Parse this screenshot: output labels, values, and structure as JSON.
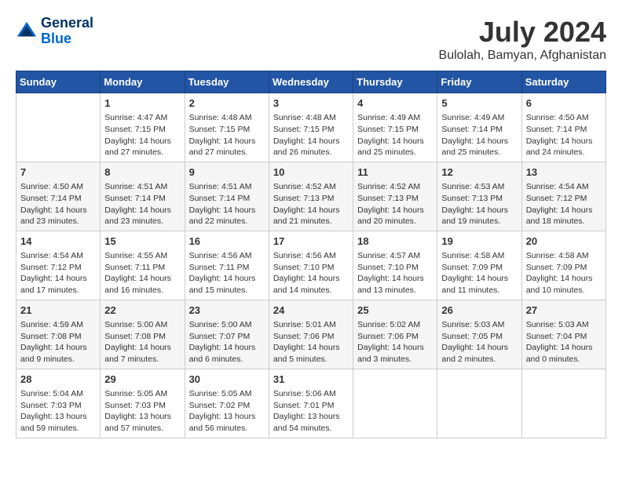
{
  "logo": {
    "line1": "General",
    "line2": "Blue"
  },
  "title": "July 2024",
  "subtitle": "Bulolah, Bamyan, Afghanistan",
  "headers": [
    "Sunday",
    "Monday",
    "Tuesday",
    "Wednesday",
    "Thursday",
    "Friday",
    "Saturday"
  ],
  "weeks": [
    [
      {
        "day": "",
        "lines": []
      },
      {
        "day": "1",
        "lines": [
          "Sunrise: 4:47 AM",
          "Sunset: 7:15 PM",
          "Daylight: 14 hours",
          "and 27 minutes."
        ]
      },
      {
        "day": "2",
        "lines": [
          "Sunrise: 4:48 AM",
          "Sunset: 7:15 PM",
          "Daylight: 14 hours",
          "and 27 minutes."
        ]
      },
      {
        "day": "3",
        "lines": [
          "Sunrise: 4:48 AM",
          "Sunset: 7:15 PM",
          "Daylight: 14 hours",
          "and 26 minutes."
        ]
      },
      {
        "day": "4",
        "lines": [
          "Sunrise: 4:49 AM",
          "Sunset: 7:15 PM",
          "Daylight: 14 hours",
          "and 25 minutes."
        ]
      },
      {
        "day": "5",
        "lines": [
          "Sunrise: 4:49 AM",
          "Sunset: 7:14 PM",
          "Daylight: 14 hours",
          "and 25 minutes."
        ]
      },
      {
        "day": "6",
        "lines": [
          "Sunrise: 4:50 AM",
          "Sunset: 7:14 PM",
          "Daylight: 14 hours",
          "and 24 minutes."
        ]
      }
    ],
    [
      {
        "day": "7",
        "lines": [
          "Sunrise: 4:50 AM",
          "Sunset: 7:14 PM",
          "Daylight: 14 hours",
          "and 23 minutes."
        ]
      },
      {
        "day": "8",
        "lines": [
          "Sunrise: 4:51 AM",
          "Sunset: 7:14 PM",
          "Daylight: 14 hours",
          "and 23 minutes."
        ]
      },
      {
        "day": "9",
        "lines": [
          "Sunrise: 4:51 AM",
          "Sunset: 7:14 PM",
          "Daylight: 14 hours",
          "and 22 minutes."
        ]
      },
      {
        "day": "10",
        "lines": [
          "Sunrise: 4:52 AM",
          "Sunset: 7:13 PM",
          "Daylight: 14 hours",
          "and 21 minutes."
        ]
      },
      {
        "day": "11",
        "lines": [
          "Sunrise: 4:52 AM",
          "Sunset: 7:13 PM",
          "Daylight: 14 hours",
          "and 20 minutes."
        ]
      },
      {
        "day": "12",
        "lines": [
          "Sunrise: 4:53 AM",
          "Sunset: 7:13 PM",
          "Daylight: 14 hours",
          "and 19 minutes."
        ]
      },
      {
        "day": "13",
        "lines": [
          "Sunrise: 4:54 AM",
          "Sunset: 7:12 PM",
          "Daylight: 14 hours",
          "and 18 minutes."
        ]
      }
    ],
    [
      {
        "day": "14",
        "lines": [
          "Sunrise: 4:54 AM",
          "Sunset: 7:12 PM",
          "Daylight: 14 hours",
          "and 17 minutes."
        ]
      },
      {
        "day": "15",
        "lines": [
          "Sunrise: 4:55 AM",
          "Sunset: 7:11 PM",
          "Daylight: 14 hours",
          "and 16 minutes."
        ]
      },
      {
        "day": "16",
        "lines": [
          "Sunrise: 4:56 AM",
          "Sunset: 7:11 PM",
          "Daylight: 14 hours",
          "and 15 minutes."
        ]
      },
      {
        "day": "17",
        "lines": [
          "Sunrise: 4:56 AM",
          "Sunset: 7:10 PM",
          "Daylight: 14 hours",
          "and 14 minutes."
        ]
      },
      {
        "day": "18",
        "lines": [
          "Sunrise: 4:57 AM",
          "Sunset: 7:10 PM",
          "Daylight: 14 hours",
          "and 13 minutes."
        ]
      },
      {
        "day": "19",
        "lines": [
          "Sunrise: 4:58 AM",
          "Sunset: 7:09 PM",
          "Daylight: 14 hours",
          "and 11 minutes."
        ]
      },
      {
        "day": "20",
        "lines": [
          "Sunrise: 4:58 AM",
          "Sunset: 7:09 PM",
          "Daylight: 14 hours",
          "and 10 minutes."
        ]
      }
    ],
    [
      {
        "day": "21",
        "lines": [
          "Sunrise: 4:59 AM",
          "Sunset: 7:08 PM",
          "Daylight: 14 hours",
          "and 9 minutes."
        ]
      },
      {
        "day": "22",
        "lines": [
          "Sunrise: 5:00 AM",
          "Sunset: 7:08 PM",
          "Daylight: 14 hours",
          "and 7 minutes."
        ]
      },
      {
        "day": "23",
        "lines": [
          "Sunrise: 5:00 AM",
          "Sunset: 7:07 PM",
          "Daylight: 14 hours",
          "and 6 minutes."
        ]
      },
      {
        "day": "24",
        "lines": [
          "Sunrise: 5:01 AM",
          "Sunset: 7:06 PM",
          "Daylight: 14 hours",
          "and 5 minutes."
        ]
      },
      {
        "day": "25",
        "lines": [
          "Sunrise: 5:02 AM",
          "Sunset: 7:06 PM",
          "Daylight: 14 hours",
          "and 3 minutes."
        ]
      },
      {
        "day": "26",
        "lines": [
          "Sunrise: 5:03 AM",
          "Sunset: 7:05 PM",
          "Daylight: 14 hours",
          "and 2 minutes."
        ]
      },
      {
        "day": "27",
        "lines": [
          "Sunrise: 5:03 AM",
          "Sunset: 7:04 PM",
          "Daylight: 14 hours",
          "and 0 minutes."
        ]
      }
    ],
    [
      {
        "day": "28",
        "lines": [
          "Sunrise: 5:04 AM",
          "Sunset: 7:03 PM",
          "Daylight: 13 hours",
          "and 59 minutes."
        ]
      },
      {
        "day": "29",
        "lines": [
          "Sunrise: 5:05 AM",
          "Sunset: 7:03 PM",
          "Daylight: 13 hours",
          "and 57 minutes."
        ]
      },
      {
        "day": "30",
        "lines": [
          "Sunrise: 5:05 AM",
          "Sunset: 7:02 PM",
          "Daylight: 13 hours",
          "and 56 minutes."
        ]
      },
      {
        "day": "31",
        "lines": [
          "Sunrise: 5:06 AM",
          "Sunset: 7:01 PM",
          "Daylight: 13 hours",
          "and 54 minutes."
        ]
      },
      {
        "day": "",
        "lines": []
      },
      {
        "day": "",
        "lines": []
      },
      {
        "day": "",
        "lines": []
      }
    ]
  ]
}
